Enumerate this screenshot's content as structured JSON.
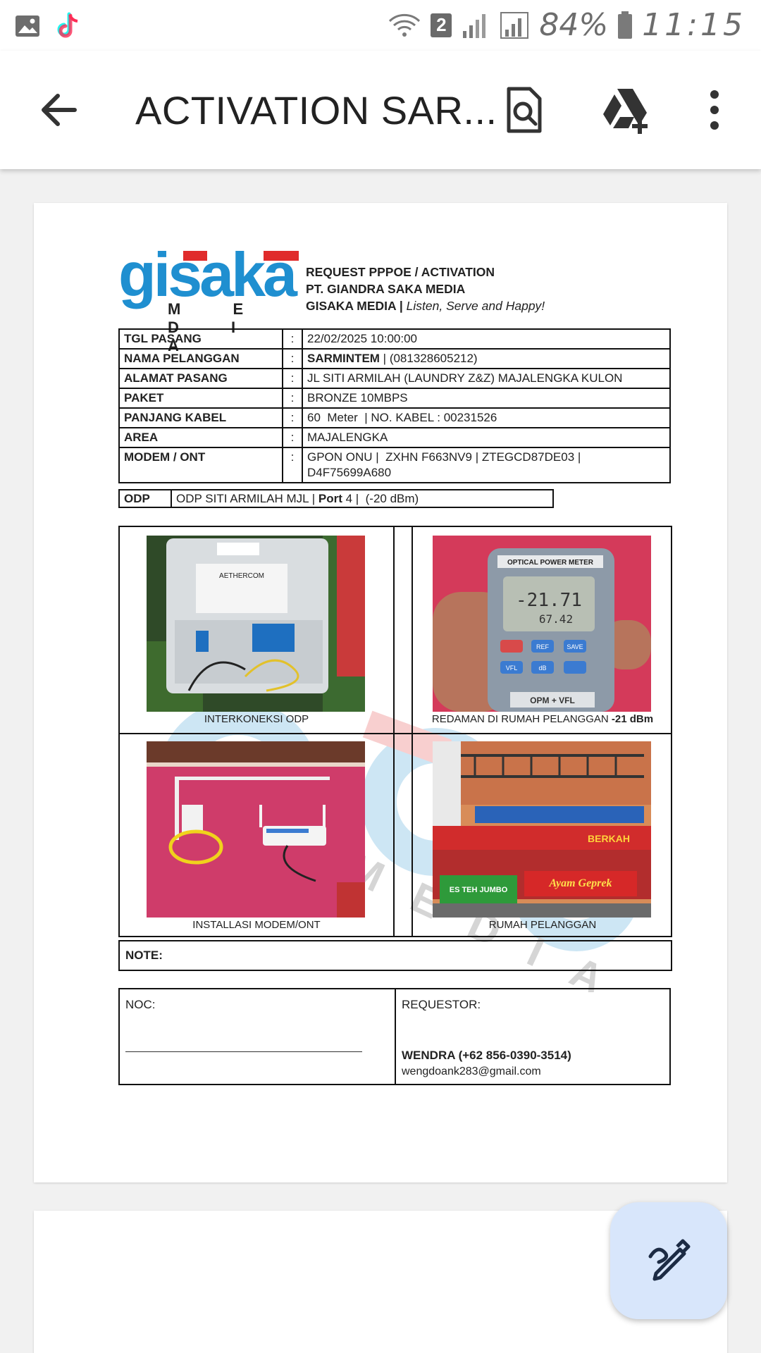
{
  "status_bar": {
    "battery_text": "84%",
    "time": "11:15",
    "sim_badge": "2"
  },
  "app_bar": {
    "title": "ACTIVATION SAR...",
    "icons": [
      "back-arrow-icon",
      "document-search-icon",
      "drive-add-icon",
      "more-vert-icon"
    ]
  },
  "document": {
    "logo": {
      "wordmark": "gisaka",
      "subtext": "M E D I A"
    },
    "header": {
      "line1": "REQUEST PPPOE / ACTIVATION",
      "line2": "PT. GIANDRA SAKA MEDIA",
      "line3_bold": "GISAKA MEDIA |",
      "line3_italic": "Listen, Serve and Happy!"
    },
    "info_rows": [
      {
        "label": "TGL PASANG",
        "colon": ":",
        "value": "22/02/2025 10:00:00"
      },
      {
        "label": "NAMA PELANGGAN",
        "colon": ":",
        "value_bold": "SARMINTEM",
        "value": " | (081328605212)"
      },
      {
        "label": "ALAMAT PASANG",
        "colon": ":",
        "value": "JL SITI ARMILAH (LAUNDRY Z&Z) MAJALENGKA KULON"
      },
      {
        "label": "PAKET",
        "colon": ":",
        "value": "BRONZE 10MBPS"
      },
      {
        "label": "PANJANG KABEL",
        "colon": ":",
        "value": "60  Meter  | NO. KABEL : 00231526"
      },
      {
        "label": "AREA",
        "colon": ":",
        "value": "MAJALENGKA"
      },
      {
        "label": "MODEM / ONT",
        "colon": ":",
        "value": "GPON ONU |  ZXHN F663NV9 | ZTEGCD87DE03 |",
        "value2": "D4F75699A680"
      }
    ],
    "odp": {
      "label": "ODP",
      "value_prefix": "ODP SITI ARMILAH MJL |",
      "port_label": "Port",
      "value_suffix": " 4 |  (-20 dBm)"
    },
    "photos": [
      {
        "caption": "INTERKONEKSI ODP",
        "caption_bold": ""
      },
      {
        "caption": "REDAMAN DI RUMAH PELANGGAN ",
        "caption_bold": "-21 dBm"
      },
      {
        "caption": "INSTALLASI MODEM/ONT",
        "caption_bold": ""
      },
      {
        "caption": "RUMAH PELANGGAN",
        "caption_bold": ""
      }
    ],
    "photo_texts": {
      "odp_brand": "AETHERCOM",
      "meter_title": "OPTICAL POWER METER",
      "meter_reading": "-21.71",
      "meter_reading2": "67.42",
      "meter_brand": "OPM + VFL",
      "meter_btn_ref": "REF",
      "meter_btn_save": "SAVE",
      "meter_btn_db": "dB",
      "meter_btn_vfl": "VFL",
      "shop_sign": "Ayam Geprek",
      "shop_sign2": "BERKAH",
      "shop_banner": "ES TEH JUMBO"
    },
    "note_label": "NOTE:",
    "signature": {
      "noc_label": "NOC:",
      "requestor_label": "REQUESTOR:",
      "requestor_name": "WENDRA (+62 856-0390-3514)",
      "requestor_email": "wengdoank283@gmail.com"
    },
    "watermark_text": "MEDIA"
  },
  "fab": {
    "icon": "edit-pen-icon"
  },
  "colors": {
    "logo_blue": "#1f8fd0",
    "logo_red": "#e02b2b",
    "fab_bg": "#d8e6fb",
    "page_bg": "#f1f1f1"
  }
}
